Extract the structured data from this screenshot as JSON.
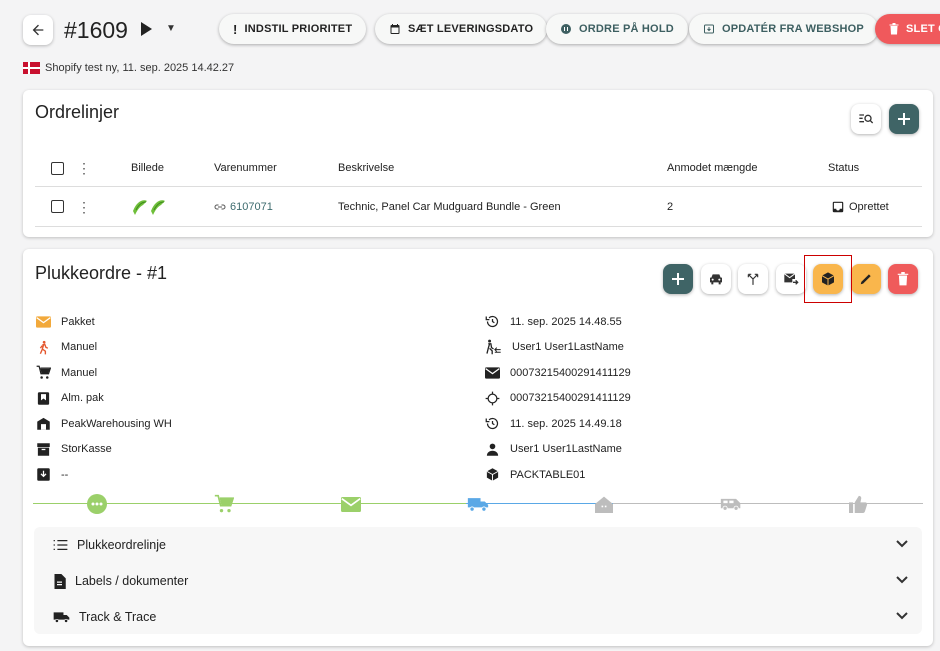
{
  "header": {
    "order_number": "#1609",
    "source_info": "Shopify test ny, 11. sep. 2025 14.42.27",
    "actions": [
      {
        "label": "INDSTIL PRIORITET",
        "icon": "exclamation-icon"
      },
      {
        "label": "SÆT LEVERINGSDATO",
        "icon": "calendar-icon"
      },
      {
        "label": "ORDRE PÅ HOLD",
        "icon": "pause-circle-icon"
      },
      {
        "label": "OPDATÉR FRA WEBSHOP",
        "icon": "update-icon"
      },
      {
        "label": "SLET O",
        "icon": "trash-icon"
      }
    ]
  },
  "order_lines": {
    "title": "Ordrelinjer",
    "columns": {
      "image": "Billede",
      "sku": "Varenummer",
      "description": "Beskrivelse",
      "quantity": "Anmodet mængde",
      "status": "Status"
    },
    "rows": [
      {
        "sku": "6107071",
        "description": "Technic, Panel Car Mudguard Bundle - Green",
        "quantity": "2",
        "status": "Oprettet"
      }
    ]
  },
  "pick_order": {
    "title": "Plukkeordre - #1",
    "left_info": [
      {
        "icon": "envelope-icon",
        "text": "Pakket",
        "color": "#f2a93b"
      },
      {
        "icon": "walking-person-icon",
        "text": "Manuel",
        "color": "#e4572e"
      },
      {
        "icon": "cart-icon",
        "text": "Manuel",
        "color": "#222222"
      },
      {
        "icon": "bookmark-icon",
        "text": "Alm. pak",
        "color": "#222222"
      },
      {
        "icon": "warehouse-icon",
        "text": "PeakWarehousing WH",
        "color": "#222222"
      },
      {
        "icon": "archive-box-icon",
        "text": "StorKasse",
        "color": "#222222"
      },
      {
        "icon": "download-box-icon",
        "text": "--",
        "color": "#222222"
      }
    ],
    "right_info": [
      {
        "icon": "history-icon",
        "text": "11. sep. 2025 14.48.55"
      },
      {
        "icon": "person-pick-icon",
        "text": "User1 User1LastName"
      },
      {
        "icon": "mail-icon",
        "text": "00073215400291411129"
      },
      {
        "icon": "target-icon",
        "text": "00073215400291411129"
      },
      {
        "icon": "history-icon",
        "text": "11. sep. 2025 14.49.18"
      },
      {
        "icon": "person-icon",
        "text": "User1 User1LastName"
      },
      {
        "icon": "package-icon",
        "text": "PACKTABLE01"
      }
    ],
    "progress_steps": [
      {
        "icon": "dots-icon",
        "color": "#9bd06a"
      },
      {
        "icon": "cart-icon",
        "color": "#9bd06a"
      },
      {
        "icon": "mail-icon",
        "color": "#9bd06a"
      },
      {
        "icon": "truck-icon",
        "color": "#5aa8e6"
      },
      {
        "icon": "home-icon",
        "color": "#bdbdbd"
      },
      {
        "icon": "van-icon",
        "color": "#bdbdbd"
      },
      {
        "icon": "thumbs-up-icon",
        "color": "#bdbdbd"
      }
    ],
    "sections": [
      {
        "label": "Plukkeordrelinje",
        "icon": "list-icon"
      },
      {
        "label": "Labels / dokumenter",
        "icon": "document-icon"
      },
      {
        "label": "Track & Trace",
        "icon": "truck-icon"
      }
    ]
  }
}
